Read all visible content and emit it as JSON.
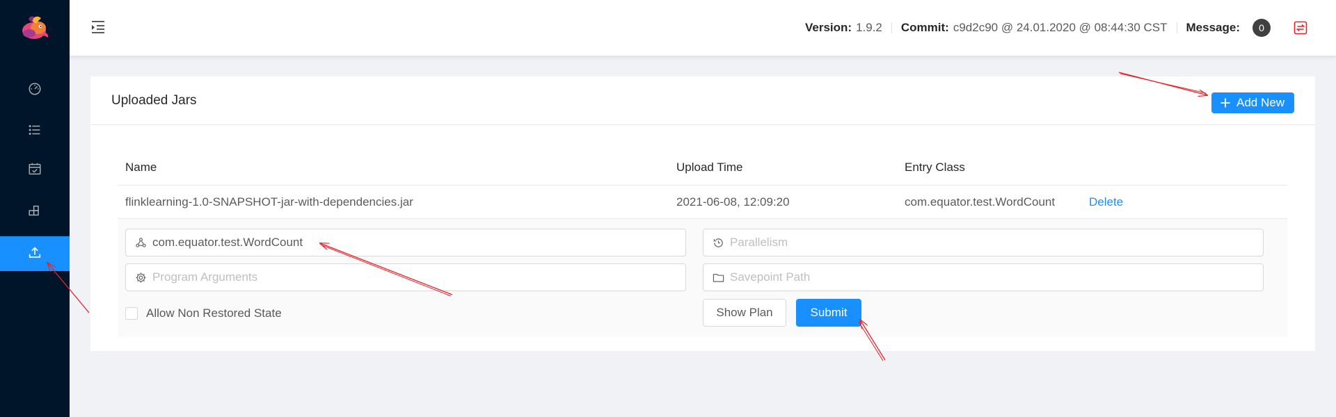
{
  "header": {
    "version_label": "Version:",
    "version_value": "1.9.2",
    "commit_label": "Commit:",
    "commit_value": "c9d2c90 @ 24.01.2020 @ 08:44:30 CST",
    "message_label": "Message:",
    "message_count": "0"
  },
  "sidebar": {
    "items": [
      {
        "icon": "dashboard-icon"
      },
      {
        "icon": "list-icon"
      },
      {
        "icon": "calendar-check-icon"
      },
      {
        "icon": "build-icon"
      },
      {
        "icon": "upload-icon",
        "active": true
      }
    ]
  },
  "card": {
    "title": "Uploaded Jars",
    "add_label": "Add New"
  },
  "table": {
    "columns": [
      "Name",
      "Upload Time",
      "Entry Class"
    ],
    "rows": [
      {
        "name": "flinklearning-1.0-SNAPSHOT-jar-with-dependencies.jar",
        "upload_time": "2021-06-08, 12:09:20",
        "entry_class": "com.equator.test.WordCount",
        "action": "Delete"
      }
    ]
  },
  "form": {
    "entry_class_value": "com.equator.test.WordCount",
    "parallelism_placeholder": "Parallelism",
    "program_args_placeholder": "Program Arguments",
    "savepoint_placeholder": "Savepoint Path",
    "allow_non_restored_label": "Allow Non Restored State",
    "show_plan_label": "Show Plan",
    "submit_label": "Submit"
  },
  "colors": {
    "sidebar_bg": "#001529",
    "primary": "#1890ff",
    "annotation": "#e8222a"
  }
}
